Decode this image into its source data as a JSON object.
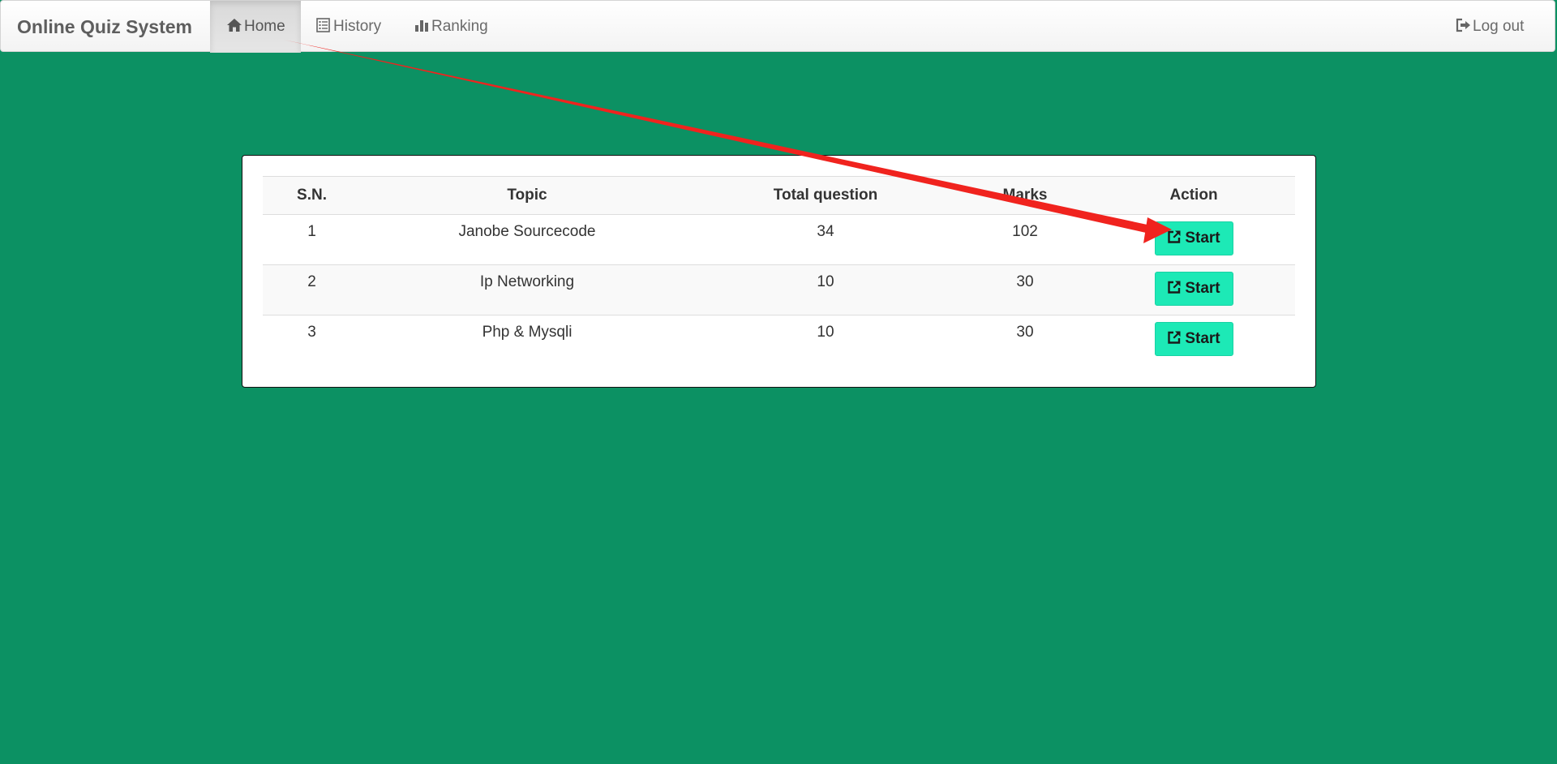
{
  "navbar": {
    "brand": "Online Quiz System",
    "items": [
      {
        "label": "Home",
        "icon": "home-icon",
        "active": true
      },
      {
        "label": "History",
        "icon": "list-icon",
        "active": false
      },
      {
        "label": "Ranking",
        "icon": "bar-chart-icon",
        "active": false
      }
    ],
    "logout": {
      "label": "Log out",
      "icon": "logout-icon"
    }
  },
  "quiz_table": {
    "headers": [
      "S.N.",
      "Topic",
      "Total question",
      "Marks",
      "Action"
    ],
    "rows": [
      {
        "sn": "1",
        "topic": "Janobe Sourcecode",
        "total_question": "34",
        "marks": "102",
        "action": "Start"
      },
      {
        "sn": "2",
        "topic": "Ip Networking",
        "total_question": "10",
        "marks": "30",
        "action": "Start"
      },
      {
        "sn": "3",
        "topic": "Php & Mysqli",
        "total_question": "10",
        "marks": "30",
        "action": "Start"
      }
    ]
  },
  "colors": {
    "page_background": "#0c9163",
    "start_button": "#1de9b6",
    "annotation_arrow": "#f0231e"
  }
}
